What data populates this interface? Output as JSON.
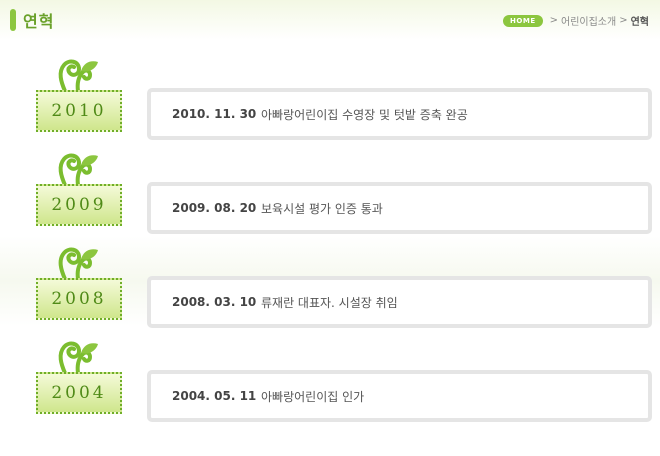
{
  "header": {
    "title": "연혁",
    "breadcrumb": {
      "home": "HOME",
      "items": [
        "어린이집소개",
        "연혁"
      ],
      "separator": ">"
    }
  },
  "timeline": [
    {
      "year": "2010",
      "date": "2010. 11. 30",
      "description": "아빠랑어린이집 수영장 및 텃밭 증축 완공"
    },
    {
      "year": "2009",
      "date": "2009. 08. 20",
      "description": "보육시설 평가 인증 통과"
    },
    {
      "year": "2008",
      "date": "2008. 03. 10",
      "description": "류재란 대표자. 시설장 취임"
    },
    {
      "year": "2004",
      "date": "2004. 05. 11",
      "description": "아빠랑어린이집 인가"
    }
  ],
  "colors": {
    "accent": "#8cc63f",
    "year_text": "#4f8a17",
    "box_border": "#e5e5e5"
  },
  "icons": {
    "title_marker": "green-bar-icon",
    "sprout": "sprout-icon"
  }
}
